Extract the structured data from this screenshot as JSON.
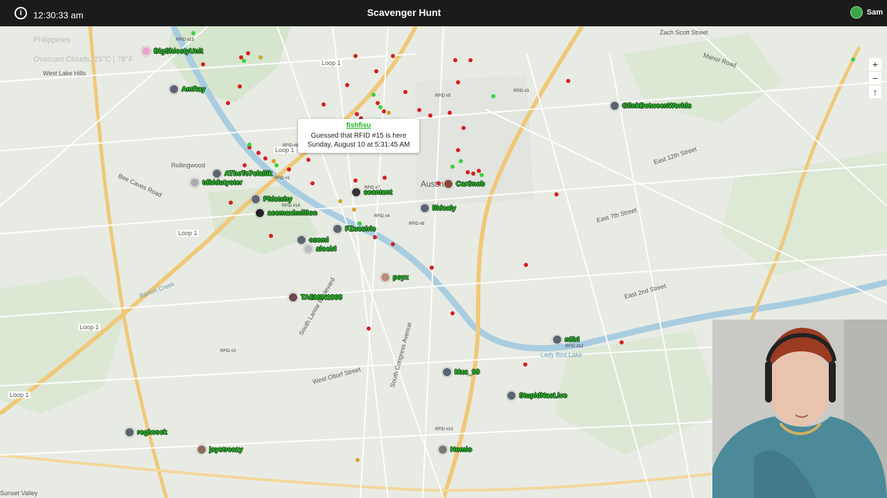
{
  "topbar": {
    "info_icon": "info-icon",
    "time": "12:30:33 am",
    "title": "Scavenger Hunt",
    "user": "Sam"
  },
  "weather": {
    "location": "Philippines",
    "conditions": "Overcast Clouds, 25°C | 78°F"
  },
  "popup": {
    "player": "fishfisu",
    "message": "Guessed that RFID #15 is here",
    "time": "Sunday, August 10 at 5:31:45 AM"
  },
  "zoom": {
    "in": "+",
    "out": "−",
    "reset": "↑"
  },
  "places": {
    "west_lake_hills": "West Lake Hills",
    "rollingwood": "Rollingwood",
    "austin": "Austin",
    "sunset_valley": "Sunset Valley",
    "loop1_a": "Loop 1",
    "loop1_b": "Loop 1",
    "loop1_c": "Loop 1",
    "loop1_d": "Loop 1",
    "loop1_e": "Loop 1",
    "zach_scott": "Zach Scott Street",
    "manor": "Manor Road",
    "e12": "East 12th Street",
    "e7": "East 7th Street",
    "e2": "East 2nd Street",
    "lady_bird": "Lady Bird Lake",
    "bee_caves": "Bee Caves Road",
    "barton_creek": "Barton Creek",
    "south_lamar": "South Lamar Boulevard",
    "south_congress": "South Congress Avenue",
    "west_oltorf": "West Oltorf Street"
  },
  "rfids": {
    "r1": "RFID #13",
    "r2": "RFID #8",
    "r3": "RFID #14",
    "r4": "RFID #4",
    "r5": "RFID #9",
    "r6": "RFID #5",
    "r7": "RFID #3",
    "r8": "RFID #7",
    "r9": "RFID #12",
    "r10": "RFID #2",
    "r11": "RFID #10",
    "r12": "RFID #1"
  },
  "players": {
    "p1": "BigShiestyUnit",
    "p2": "AmRay",
    "p3": "GlinkBetweenWorlds",
    "p4": "CarSnob",
    "p5": "seantent",
    "p6": "lildealy",
    "p7": "ATheTe7cfallik",
    "p8": "tdbidutyster",
    "p9": "Phletchy",
    "p10": "acemaximillion",
    "p11": "FZuesirle",
    "p12": "ozemi",
    "p13": "aloeirl",
    "p14": "peyx",
    "p15": "TAEMIN1998",
    "p16": "n8irl",
    "p17": "Mxc_99",
    "p18": "StupidNasLive",
    "p19": "regiwock",
    "p20": "jaystreazy",
    "p21": "Homio"
  },
  "colors": {
    "player_name": "#2ecc2e",
    "guess_wrong": "#d42020",
    "guess_right": "#3bd13b",
    "topbar": "#1b1b1b"
  }
}
